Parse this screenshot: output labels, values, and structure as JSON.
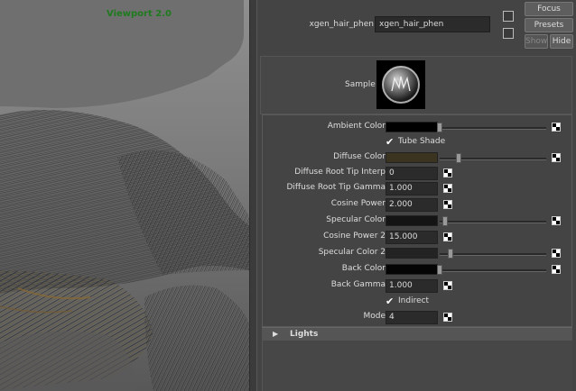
{
  "viewport": {
    "label": "Viewport 2.0"
  },
  "node": {
    "label": "xgen_hair_phen:",
    "value": "xgen_hair_phen",
    "buttons": {
      "focus": "Focus",
      "presets": "Presets",
      "show": "Show",
      "hide": "Hide"
    }
  },
  "sample": {
    "label": "Sample"
  },
  "attributes": {
    "ambient_color": {
      "label": "Ambient Color",
      "color": "#000000",
      "slider": 0.0
    },
    "tube_shade": {
      "label": "Tube Shade",
      "checked": true
    },
    "diffuse_color": {
      "label": "Diffuse Color",
      "color": "#3b3420",
      "slider": 0.18
    },
    "diffuse_root_tip_interp": {
      "label": "Diffuse Root Tip Interp",
      "value": "0"
    },
    "diffuse_root_tip_gamma": {
      "label": "Diffuse Root Tip Gamma",
      "value": "1.000"
    },
    "cosine_power": {
      "label": "Cosine Power",
      "value": "2.000"
    },
    "specular_color": {
      "label": "Specular Color",
      "color": "#141414",
      "slider": 0.05
    },
    "cosine_power_2": {
      "label": "Cosine Power 2",
      "value": "15.000"
    },
    "specular_color_2": {
      "label": "Specular Color 2",
      "color": "#232323",
      "slider": 0.1
    },
    "back_color": {
      "label": "Back Color",
      "color": "#050505",
      "slider": 0.0
    },
    "back_gamma": {
      "label": "Back Gamma",
      "value": "1.000"
    },
    "indirect": {
      "label": "Indirect",
      "checked": true
    },
    "mode": {
      "label": "Mode",
      "value": "4"
    }
  },
  "lights": {
    "label": "Lights"
  }
}
